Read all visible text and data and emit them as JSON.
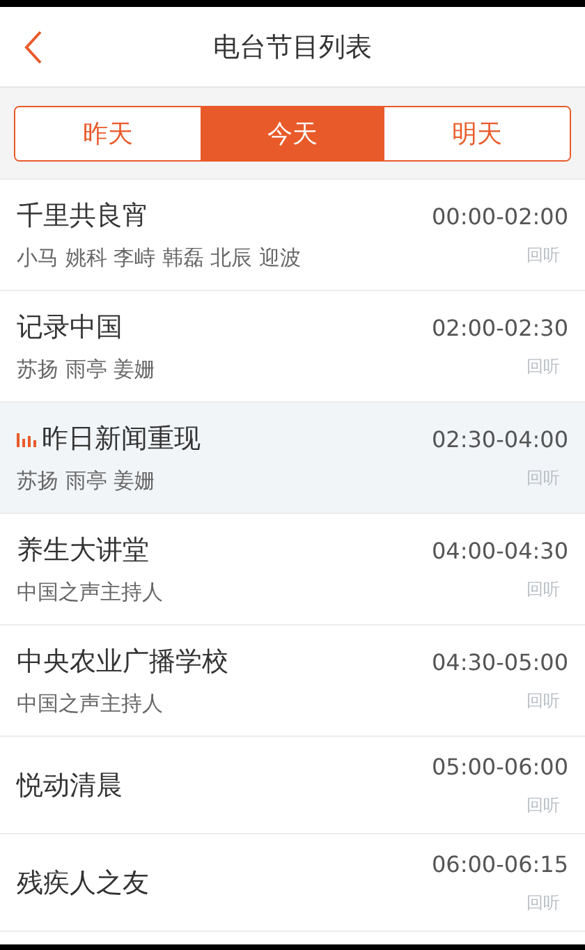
{
  "header": {
    "title": "电台节目列表"
  },
  "day_tabs": [
    {
      "label": "昨天",
      "selected": false
    },
    {
      "label": "今天",
      "selected": true
    },
    {
      "label": "明天",
      "selected": false
    }
  ],
  "programs": [
    {
      "name": "千里共良宵",
      "hosts": "小马 姚科 李峙 韩磊 北辰 迎波",
      "time": "00:00-02:00",
      "action": "回听",
      "playing": false
    },
    {
      "name": "记录中国",
      "hosts": "苏扬 雨亭 姜姗",
      "time": "02:00-02:30",
      "action": "回听",
      "playing": false
    },
    {
      "name": "昨日新闻重现",
      "hosts": "苏扬 雨亭 姜姗",
      "time": "02:30-04:00",
      "action": "回听",
      "playing": true
    },
    {
      "name": "养生大讲堂",
      "hosts": "中国之声主持人",
      "time": "04:00-04:30",
      "action": "回听",
      "playing": false
    },
    {
      "name": "中央农业广播学校",
      "hosts": "中国之声主持人",
      "time": "04:30-05:00",
      "action": "回听",
      "playing": false
    },
    {
      "name": "悦动清晨",
      "time": "05:00-06:00",
      "action": "回听",
      "playing": false
    },
    {
      "name": "残疾人之友",
      "time": "06:00-06:15",
      "action": "回听",
      "playing": false
    }
  ]
}
